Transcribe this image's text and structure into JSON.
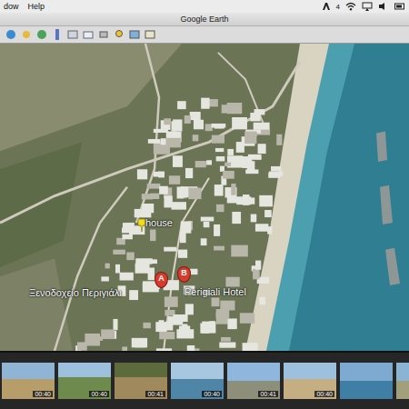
{
  "menubar": {
    "items": [
      "dow",
      "Help"
    ],
    "status": [
      "4"
    ]
  },
  "window": {
    "title": "Google Earth"
  },
  "map": {
    "placemarks": [
      {
        "marker": "",
        "label": "house",
        "kind": "pin",
        "color": "#f2dc1c"
      },
      {
        "marker": "A",
        "label": "Ξενοδοχείο Περιγιάλι",
        "kind": "marker",
        "color": "#d93a2b"
      },
      {
        "marker": "B",
        "label": "Perigiali Hotel",
        "kind": "marker",
        "color": "#d93a2b"
      }
    ]
  },
  "tour": {
    "thumbnails": [
      {
        "time": "00:40"
      },
      {
        "time": "00:40"
      },
      {
        "time": "00:41"
      },
      {
        "time": "00:40"
      },
      {
        "time": "00:41"
      },
      {
        "time": "00:40"
      },
      {
        "time": ""
      },
      {
        "time": ""
      }
    ]
  }
}
